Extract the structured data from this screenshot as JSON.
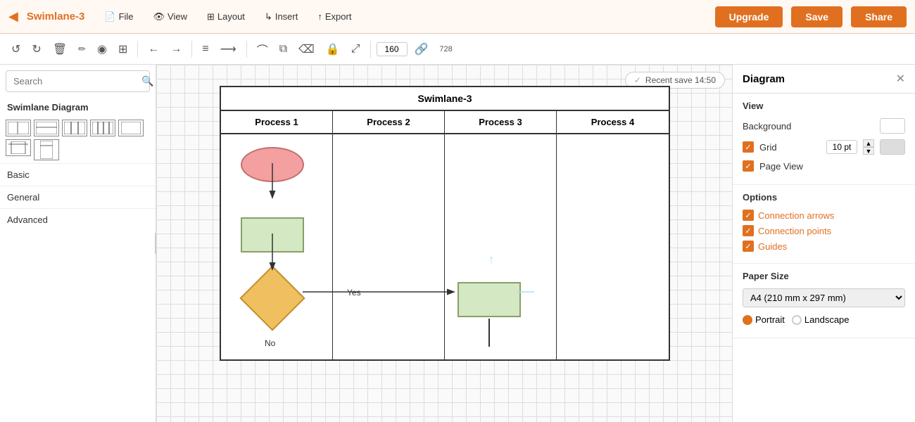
{
  "topbar": {
    "back_icon": "◀",
    "title": "Swimlane-3",
    "menu_items": [
      {
        "label": "File",
        "icon": "📄"
      },
      {
        "label": "View",
        "icon": "👁"
      },
      {
        "label": "Layout",
        "icon": "⊞"
      },
      {
        "label": "Insert",
        "icon": "↳"
      },
      {
        "label": "Export",
        "icon": "↑"
      }
    ],
    "upgrade_btn": "Upgrade",
    "save_btn": "Save",
    "share_btn": "Share"
  },
  "toolbar": {
    "undo": "↺",
    "redo": "↻",
    "delete": "🗑",
    "paint": "🖊",
    "fill": "⬤",
    "table": "⊞",
    "arrow_left": "←",
    "arrow_right": "→",
    "lines": "≡",
    "arrow_right2": "→",
    "curve": "⌒",
    "clone": "⧉",
    "eraser": "⌫",
    "lock": "🔒",
    "expand": "⤢",
    "size_val": "160",
    "link": "🔗",
    "extra": "728"
  },
  "sidebar": {
    "search_placeholder": "Search",
    "diagram_label": "Swimlane Diagram",
    "sections": [
      "Basic",
      "General",
      "Advanced"
    ]
  },
  "canvas": {
    "save_badge": "Recent save 14:50"
  },
  "swimlane": {
    "title": "Swimlane-3",
    "columns": [
      "Process 1",
      "Process 2",
      "Process 3",
      "Process 4"
    ],
    "yes_label": "Yes",
    "no_label": "No"
  },
  "right_panel": {
    "title": "Diagram",
    "close_icon": "✕",
    "view_section": {
      "title": "View",
      "background_label": "Background",
      "grid_label": "Grid",
      "grid_value": "10 pt",
      "page_view_label": "Page View"
    },
    "options_section": {
      "title": "Options",
      "items": [
        "Connection arrows",
        "Connection points",
        "Guides"
      ]
    },
    "paper_size_section": {
      "title": "Paper Size",
      "select_value": "A4 (210 mm x 297 mm)",
      "portrait_label": "Portrait",
      "landscape_label": "Landscape"
    }
  }
}
